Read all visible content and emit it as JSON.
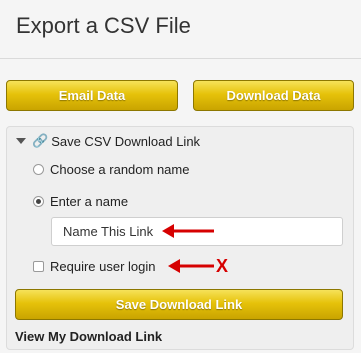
{
  "page": {
    "title": "Export a CSV File"
  },
  "buttons": {
    "email": "Email Data",
    "download": "Download Data"
  },
  "section": {
    "header": "Save CSV Download Link",
    "options": {
      "random_name": "Choose a random name",
      "enter_name": "Enter a name",
      "require_login": "Require user login"
    },
    "input_value": "Name This Link",
    "save_button": "Save Download Link",
    "view_link": "View My Download Link"
  },
  "annotations": {
    "x_mark": "X",
    "arrow_color": "#d60000"
  },
  "colors": {
    "button_gold": "#e6c20a",
    "button_border": "#8d7700"
  }
}
